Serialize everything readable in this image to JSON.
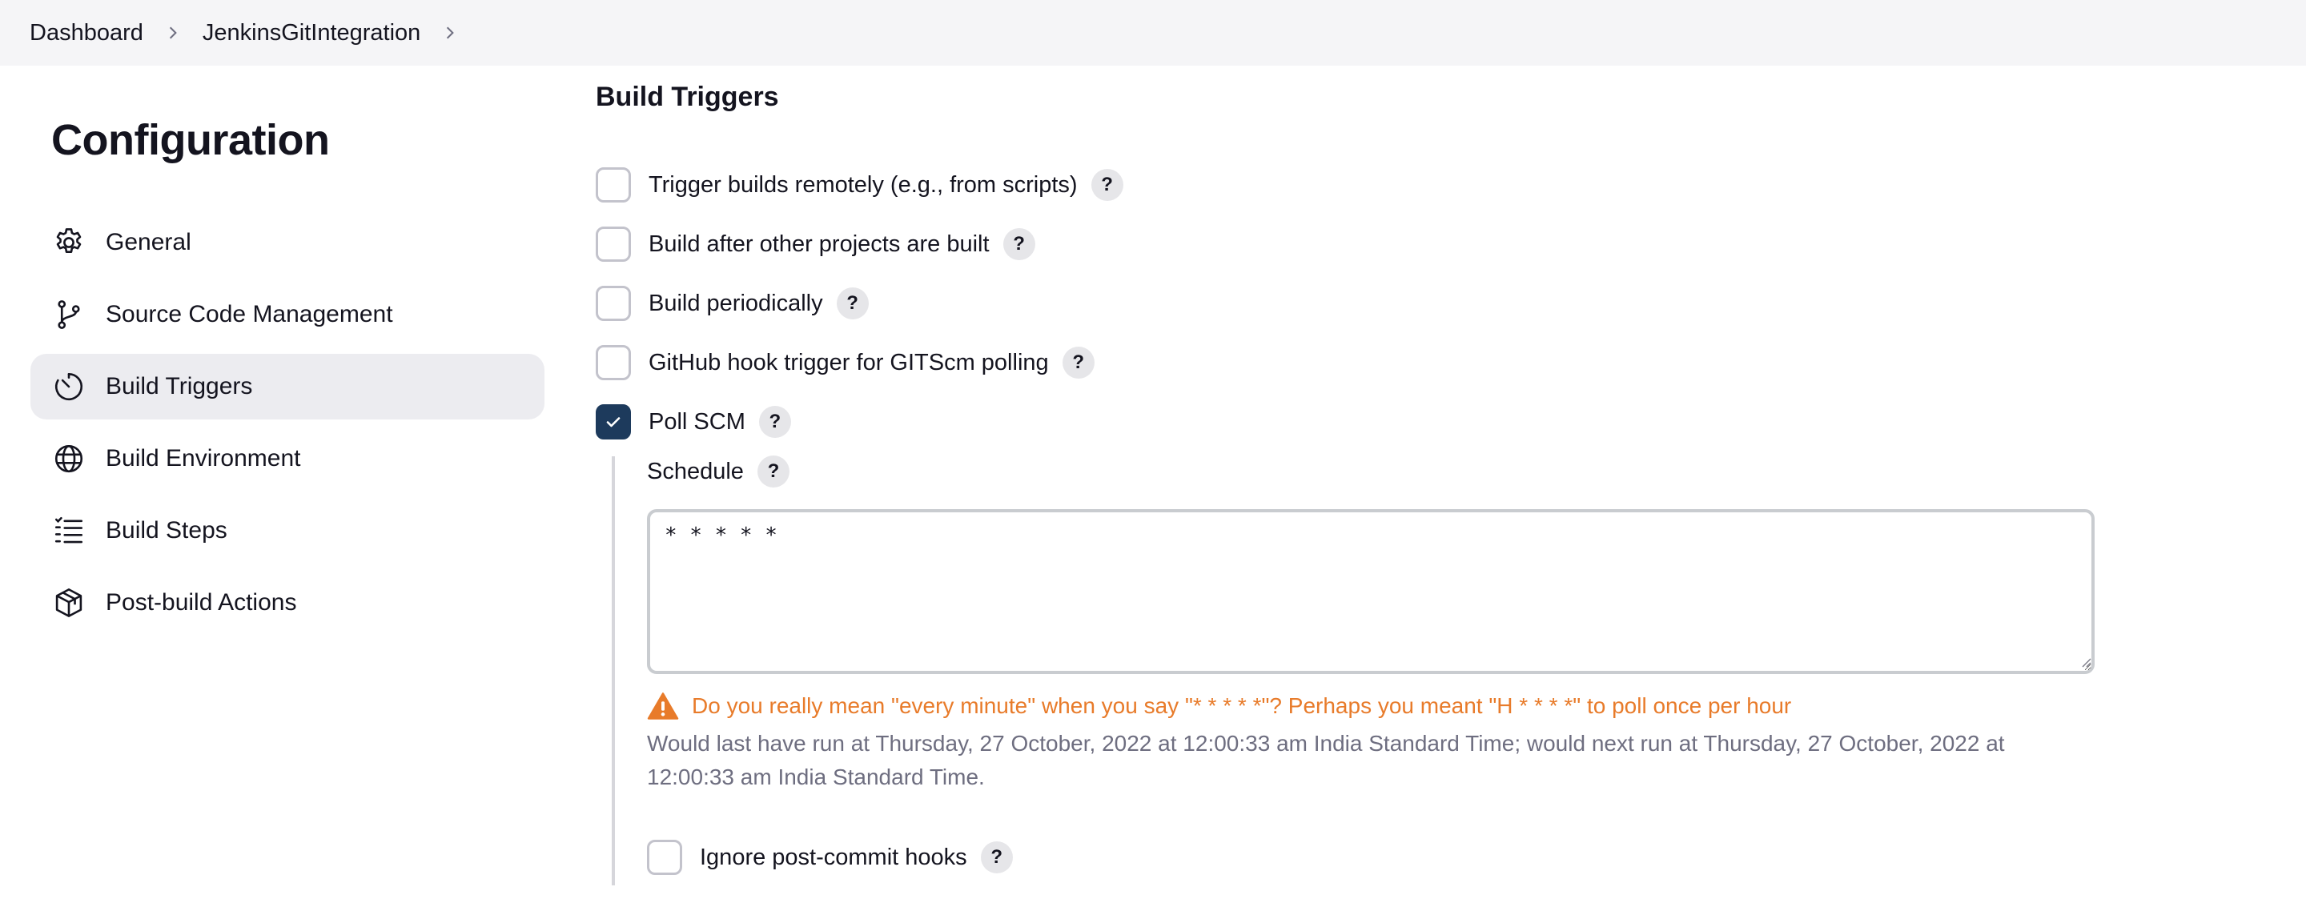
{
  "breadcrumb": {
    "items": [
      "Dashboard",
      "JenkinsGitIntegration"
    ]
  },
  "sidebar": {
    "title": "Configuration",
    "items": [
      {
        "label": "General",
        "icon": "gear-icon"
      },
      {
        "label": "Source Code Management",
        "icon": "git-branch-icon"
      },
      {
        "label": "Build Triggers",
        "icon": "timer-icon",
        "active": true
      },
      {
        "label": "Build Environment",
        "icon": "globe-icon"
      },
      {
        "label": "Build Steps",
        "icon": "list-icon"
      },
      {
        "label": "Post-build Actions",
        "icon": "package-icon"
      }
    ]
  },
  "main": {
    "section_title": "Build Triggers",
    "triggers": [
      {
        "label": "Trigger builds remotely (e.g., from scripts)",
        "checked": false
      },
      {
        "label": "Build after other projects are built",
        "checked": false
      },
      {
        "label": "Build periodically",
        "checked": false
      },
      {
        "label": "GitHub hook trigger for GITScm polling",
        "checked": false
      },
      {
        "label": "Poll SCM",
        "checked": true
      }
    ],
    "help_label": "?",
    "schedule": {
      "label": "Schedule",
      "value": "* * * * *",
      "warning": "Do you really mean \"every minute\" when you say \"* * * * *\"? Perhaps you meant \"H * * * *\" to poll once per hour",
      "info": "Would last have run at Thursday, 27 October, 2022 at 12:00:33 am India Standard Time; would next run at Thursday, 27 October, 2022 at 12:00:33 am India Standard Time."
    },
    "ignore_hooks": {
      "label": "Ignore post-commit hooks",
      "checked": false
    }
  },
  "colors": {
    "accent_checked": "#1d3a5c",
    "warning": "#e87b2a",
    "muted_text": "#6e6e80",
    "active_nav_bg": "#ececf0"
  }
}
